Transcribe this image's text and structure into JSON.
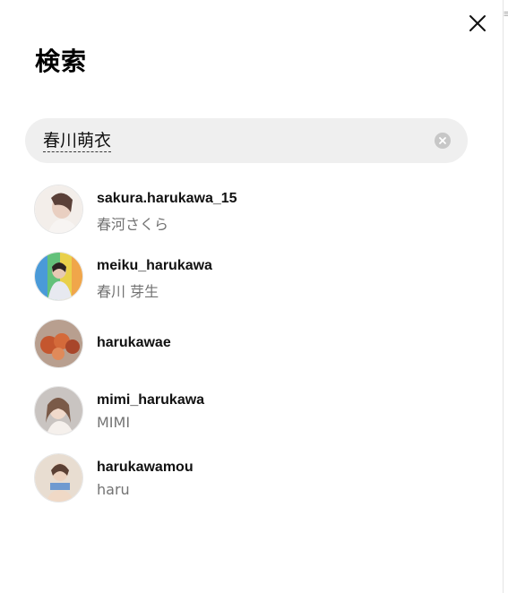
{
  "header": {
    "title": "検索",
    "close_icon": "close-icon"
  },
  "search": {
    "value": "春川萌衣",
    "clear_icon": "clear-circle-icon"
  },
  "results": [
    {
      "username": "sakura.harukawa_15",
      "fullname": "春河さくら"
    },
    {
      "username": "meiku_harukawa",
      "fullname": "春川 芽生"
    },
    {
      "username": "harukawae",
      "fullname": ""
    },
    {
      "username": "mimi_harukawa",
      "fullname": "MIMI"
    },
    {
      "username": "harukawamou",
      "fullname": "haru"
    }
  ],
  "colors": {
    "search_background": "#efefef",
    "secondary_text": "#737373"
  }
}
